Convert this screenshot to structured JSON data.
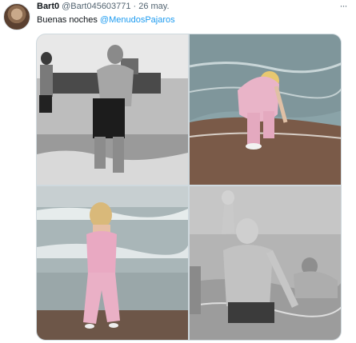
{
  "tweet": {
    "display_name": "Bart0",
    "handle": "@Bart045603771",
    "separator": "·",
    "date": "26 may.",
    "text": "Buenas noches",
    "mention": "@MenudosPajaros",
    "more_icon": "more-horizontal-icon"
  },
  "media": [
    {
      "type": "photo",
      "style": "black-and-white"
    },
    {
      "type": "photo",
      "style": "color"
    },
    {
      "type": "photo",
      "style": "color"
    },
    {
      "type": "photo",
      "style": "black-and-white"
    }
  ],
  "colors": {
    "mention": "#1d9bf0",
    "secondary_text": "#536471",
    "primary_text": "#0f1419"
  }
}
